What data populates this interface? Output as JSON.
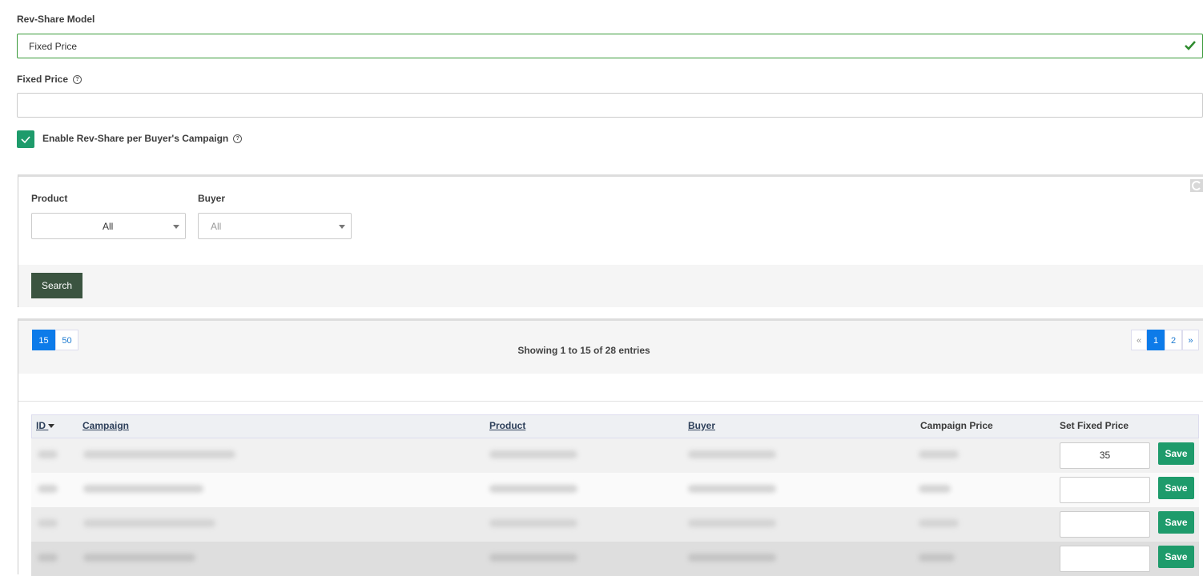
{
  "form": {
    "rev_share_label": "Rev-Share Model",
    "rev_share_value": "Fixed Price",
    "fixed_price_label": "Fixed Price",
    "fixed_price_value": "",
    "enable_label": "Enable Rev-Share per Buyer's Campaign",
    "help_glyph": "?"
  },
  "filters": {
    "product_label": "Product",
    "product_value": "All",
    "buyer_label": "Buyer",
    "buyer_value": "All",
    "search_label": "Search"
  },
  "table_controls": {
    "page_sizes": [
      "15",
      "50"
    ],
    "showing_text": "Showing 1 to 15 of 28 entries",
    "pagination": {
      "prev": "«",
      "pages": [
        "1",
        "2"
      ],
      "next": "»"
    }
  },
  "table": {
    "headers": {
      "id": "ID",
      "campaign": "Campaign",
      "product": "Product",
      "buyer": "Buyer",
      "campaign_price": "Campaign Price",
      "set_fixed_price": "Set Fixed Price"
    },
    "rows": [
      {
        "fixed_price": "35",
        "save": "Save"
      },
      {
        "fixed_price": "",
        "save": "Save"
      },
      {
        "fixed_price": "",
        "save": "Save"
      },
      {
        "fixed_price": "",
        "save": "Save"
      }
    ]
  },
  "colors": {
    "accent_green": "#1e9b6b",
    "search_btn": "#3b5440",
    "page_active": "#0d7be9",
    "valid_border": "#3a9a3a"
  }
}
